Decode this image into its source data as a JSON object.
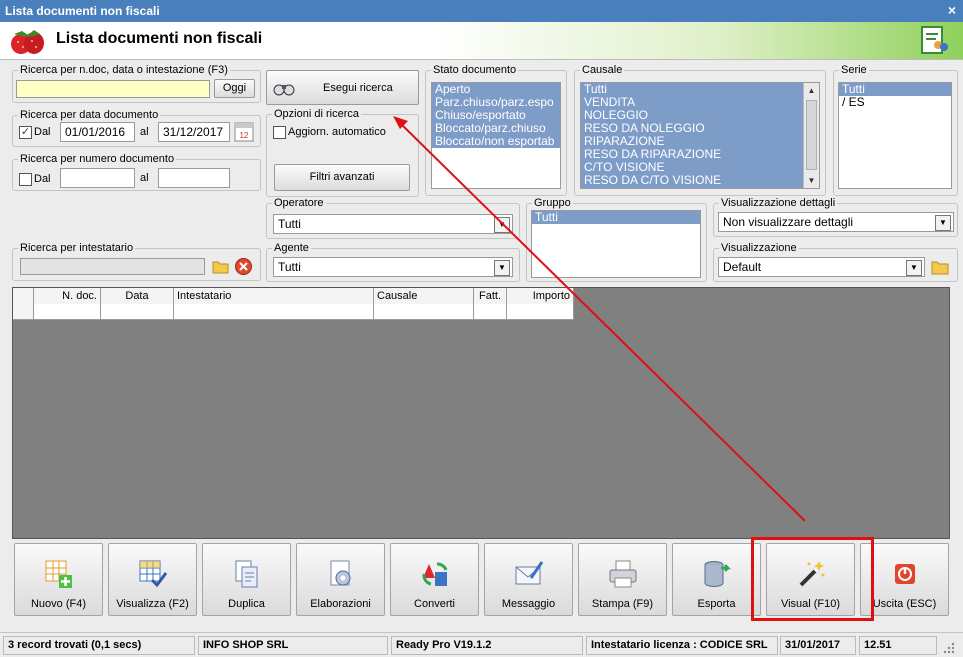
{
  "window": {
    "title": "Lista documenti non fiscali",
    "close_glyph": "×"
  },
  "header": {
    "title": "Lista documenti non fiscali"
  },
  "search_text": {
    "legend": "Ricerca per n.doc, data o intestazione (F3)",
    "value": "",
    "button": "Oggi"
  },
  "search_date": {
    "legend": "Ricerca per data documento",
    "from_label": "Dal",
    "from": "01/01/2016",
    "to_label": "al",
    "to": "31/12/2017"
  },
  "search_number": {
    "legend": "Ricerca per numero documento",
    "from_label": "Dal",
    "from": "",
    "to_label": "al",
    "to": ""
  },
  "search_holder": {
    "legend": "Ricerca per intestatario",
    "value": ""
  },
  "run_search": {
    "label": "Esegui ricerca"
  },
  "options": {
    "legend": "Opzioni di ricerca",
    "auto_update": "Aggiorn. automatico",
    "advanced_filters": "Filtri avanzati"
  },
  "stato": {
    "legend": "Stato documento",
    "items": [
      "Aperto",
      "Parz.chiuso/parz.espo",
      "Chiuso/esportato",
      "Bloccato/parz.chiuso",
      "Bloccato/non esportab"
    ]
  },
  "causale": {
    "legend": "Causale",
    "items": [
      "Tutti",
      "VENDITA",
      "NOLEGGIO",
      "RESO DA NOLEGGIO",
      "RIPARAZIONE",
      "RESO DA RIPARAZIONE",
      "C/TO VISIONE",
      "RESO DA C/TO VISIONE"
    ]
  },
  "serie": {
    "legend": "Serie",
    "items": [
      "Tutti",
      "/ ES"
    ]
  },
  "operatore": {
    "legend": "Operatore",
    "value": "Tutti"
  },
  "agente": {
    "legend": "Agente",
    "value": "Tutti"
  },
  "gruppo": {
    "legend": "Gruppo",
    "items": [
      "Tutti"
    ]
  },
  "vis_dettagli": {
    "legend": "Visualizzazione dettagli",
    "value": "Non visualizzare dettagli"
  },
  "visualizzazione": {
    "legend": "Visualizzazione",
    "value": "Default"
  },
  "table": {
    "columns": [
      "N. doc.",
      "Data",
      "Intestatario",
      "Causale",
      "Fatt.",
      "Importo"
    ]
  },
  "toolbar": {
    "nuovo": "Nuovo (F4)",
    "visualizza": "Visualizza (F2)",
    "duplica": "Duplica",
    "elaborazioni": "Elaborazioni",
    "converti": "Converti",
    "messaggio": "Messaggio",
    "stampa": "Stampa (F9)",
    "esporta": "Esporta",
    "visual": "Visual (F10)",
    "uscita": "Uscita (ESC)"
  },
  "status": {
    "records": "3 record trovati (0,1 secs)",
    "company": "INFO SHOP SRL",
    "version": "Ready Pro V19.1.2",
    "license": "Intestatario licenza : CODICE SRL",
    "date": "31/01/2017",
    "time": "12.51"
  },
  "colors": {
    "title_bar": "#4a7fbe",
    "selection": "#7e9cc8",
    "annotation": "#e01010",
    "grid_bg": "#808080"
  }
}
